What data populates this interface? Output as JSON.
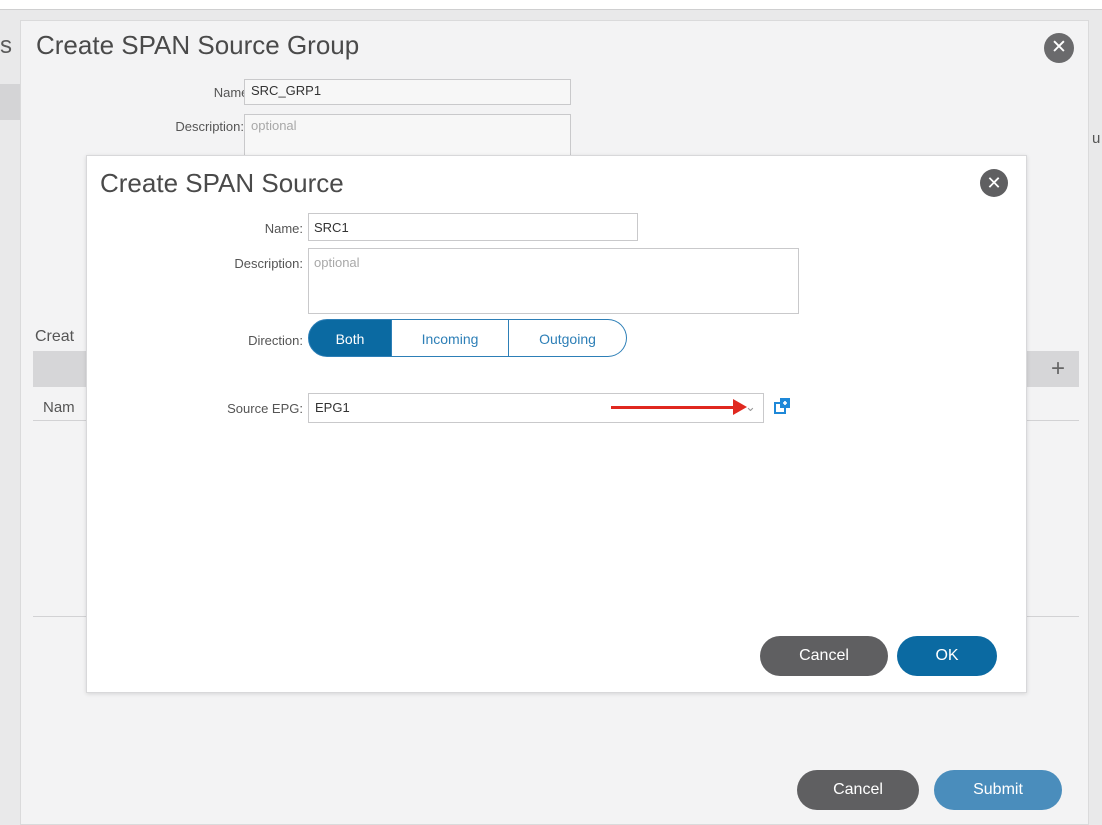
{
  "background": {
    "left_text": "s",
    "right_text": "u"
  },
  "outer_dialog": {
    "title": "Create SPAN Source Group",
    "close_icon": "close-icon",
    "name_label": "Name:",
    "name_value": "SRC_GRP1",
    "description_label": "Description:",
    "description_placeholder": "optional",
    "section_label": "Creat",
    "column_label": "Nam",
    "add_icon": "plus-icon",
    "cancel_label": "Cancel",
    "submit_label": "Submit"
  },
  "inner_dialog": {
    "title": "Create SPAN Source",
    "close_icon": "close-icon",
    "name_label": "Name:",
    "name_value": "SRC1",
    "description_label": "Description:",
    "description_placeholder": "optional",
    "direction_label": "Direction:",
    "direction_options": [
      "Both",
      "Incoming",
      "Outgoing"
    ],
    "direction_selected": "Both",
    "source_epg_label": "Source EPG:",
    "source_epg_value": "EPG1",
    "dropdown_icon": "chevron-down-icon",
    "copy_icon": "copy-icon",
    "cancel_label": "Cancel",
    "ok_label": "OK"
  },
  "colors": {
    "primary": "#0b6aa2",
    "submit": "#4a8dbc",
    "cancel": "#5f5f61",
    "annotation_arrow": "#e0281f"
  }
}
